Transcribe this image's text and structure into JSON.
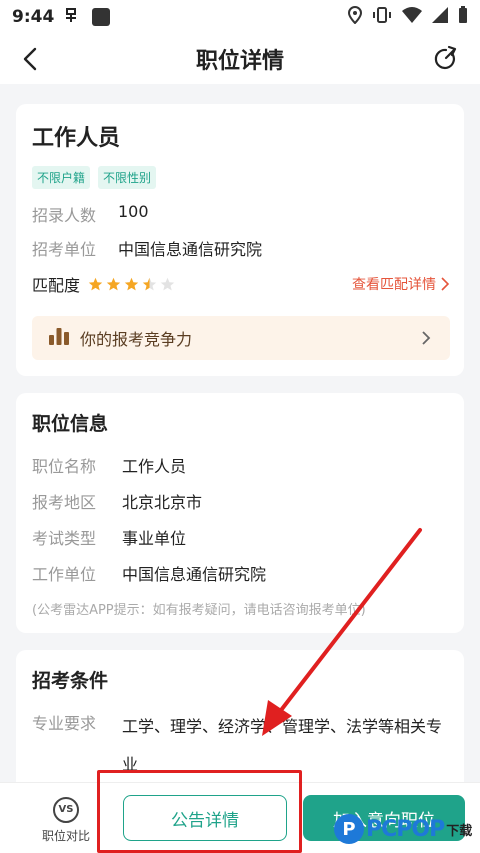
{
  "status": {
    "time": "9:44"
  },
  "nav": {
    "title": "职位详情"
  },
  "job": {
    "title": "工作人员",
    "tags": [
      "不限户籍",
      "不限性别"
    ],
    "recruit_label": "招录人数",
    "recruit_value": "100",
    "unit_label": "招考单位",
    "unit_value": "中国信息通信研究院",
    "match_label": "匹配度",
    "match_rating": 3.5,
    "match_max": 5,
    "match_link": "查看匹配详情",
    "compete_label": "你的报考竞争力"
  },
  "position_info": {
    "title": "职位信息",
    "rows": [
      {
        "k": "职位名称",
        "v": "工作人员"
      },
      {
        "k": "报考地区",
        "v": "北京北京市"
      },
      {
        "k": "考试类型",
        "v": "事业单位"
      },
      {
        "k": "工作单位",
        "v": "中国信息通信研究院"
      }
    ],
    "hint": "(公考雷达APP提示：如有报考疑问，请电话咨询报考单位)"
  },
  "conditions": {
    "title": "招考条件",
    "major_label": "专业要求",
    "major_value": "工学、理学、经济学、管理学、法学等相关专业"
  },
  "bottom": {
    "compare_label": "职位对比",
    "compare_icon": "VS",
    "notice_button": "公告详情",
    "primary_button": "加入意向职位"
  },
  "watermark": {
    "logo": "P",
    "brand": "PCPOP",
    "suffix": "下载"
  },
  "colors": {
    "accent": "#1fa38a",
    "warning": "#e5553b",
    "annotation": "#e02020"
  }
}
